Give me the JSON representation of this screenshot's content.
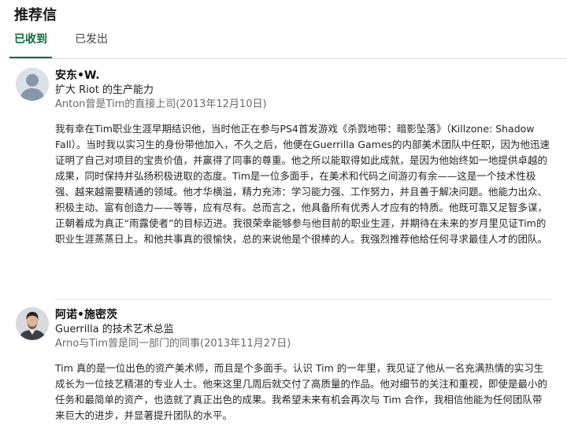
{
  "section": {
    "title": "推荐信"
  },
  "tabs": [
    {
      "label": "已收到",
      "active": true
    },
    {
      "label": "已发出",
      "active": false
    }
  ],
  "recommendations": [
    {
      "name": "安东•W.",
      "title": "扩大 Riot 的生产能力",
      "relation": "Anton曾是Tim的直接上司(2013年12月10日)",
      "text": "我有幸在Tim职业生涯早期结识他，当时他正在参与PS4首发游戏《杀戮地带：暗影坠落》（Killzone: Shadow Fall）。当时我以实习生的身份带他加入，不久之后，他便在Guerrilla Games的内部美术团队中任职，因为他迅速证明了自己对项目的宝贵价值，并赢得了同事的尊重。他之所以能取得如此成就，是因为他始终如一地提供卓越的成果，同时保持并弘扬积极进取的态度。Tim是一位多面手，在美术和代码之间游刃有余——这是一个技术性极强、越来越需要精通的领域。他才华横溢，精力充沛：学习能力强、工作努力，并且善于解决问题。他能力出众、积极主动、富有创造力——等等，应有尽有。总而言之，他具备所有优秀人才应有的特质。他既可靠又足智多谋，正朝着成为真正“雨露使者”的目标迈进。我很荣幸能够参与他目前的职业生涯，并期待在未来的岁月里见证Tim的职业生涯蒸蒸日上。和他共事真的很愉快，总的来说他是个很棒的人。我强烈推荐他给任何寻求最佳人才的团队。"
    },
    {
      "name": "阿诺•施密茨",
      "title": "Guerrilla 的技术艺术总监",
      "relation": "Arno与Tim曾是同一部门的同事(2013年11月27日)",
      "text": "Tim 真的是一位出色的资产美术师，而且是个多面手。认识 Tim 的一年里，我见证了他从一名充满热情的实习生成长为一位技艺精湛的专业人士。他来这里几周后就交付了高质量的作品。他对细节的关注和重视，即使是最小的任务和最简单的资产，也造就了真正出色的成果。我希望未来有机会再次与 Tim 合作，我相信他能为任何团队带来巨大的进步，并显著提升团队的水平。"
    }
  ]
}
